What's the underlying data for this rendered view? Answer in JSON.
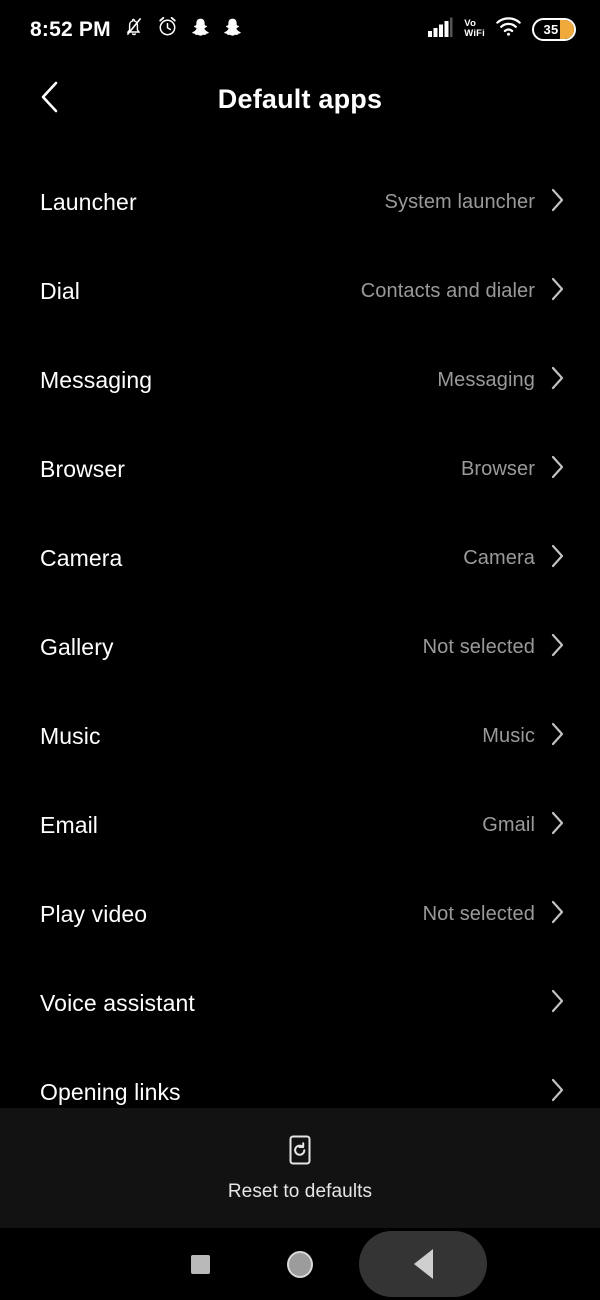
{
  "status_bar": {
    "time": "8:52 PM",
    "left_icons": [
      "notifications-muted-icon",
      "alarm-icon",
      "snapchat-icon",
      "snapchat-icon"
    ],
    "signal_icon": "cellular-signal-icon",
    "vowifi_line1": "Vo",
    "vowifi_line2": "WiFi",
    "wifi_icon": "wifi-icon",
    "battery_level": "35",
    "battery_fill_color": "#f0a93b"
  },
  "header": {
    "back_icon": "chevron-left-icon",
    "title": "Default apps"
  },
  "list": {
    "chevron_icon": "chevron-right-icon",
    "rows": [
      {
        "label": "Launcher",
        "value": "System launcher"
      },
      {
        "label": "Dial",
        "value": "Contacts and dialer"
      },
      {
        "label": "Messaging",
        "value": "Messaging"
      },
      {
        "label": "Browser",
        "value": "Browser"
      },
      {
        "label": "Camera",
        "value": "Camera"
      },
      {
        "label": "Gallery",
        "value": "Not selected"
      },
      {
        "label": "Music",
        "value": "Music"
      },
      {
        "label": "Email",
        "value": "Gmail"
      },
      {
        "label": "Play video",
        "value": "Not selected"
      },
      {
        "label": "Voice assistant",
        "value": ""
      },
      {
        "label": "Opening links",
        "value": ""
      }
    ]
  },
  "footer": {
    "icon": "restore-defaults-icon",
    "label": "Reset to defaults"
  },
  "nav_bar": {
    "recents_icon": "square-recents-icon",
    "home_icon": "circle-home-icon",
    "back_icon": "triangle-back-icon",
    "back_highlight_color": "#343434"
  }
}
